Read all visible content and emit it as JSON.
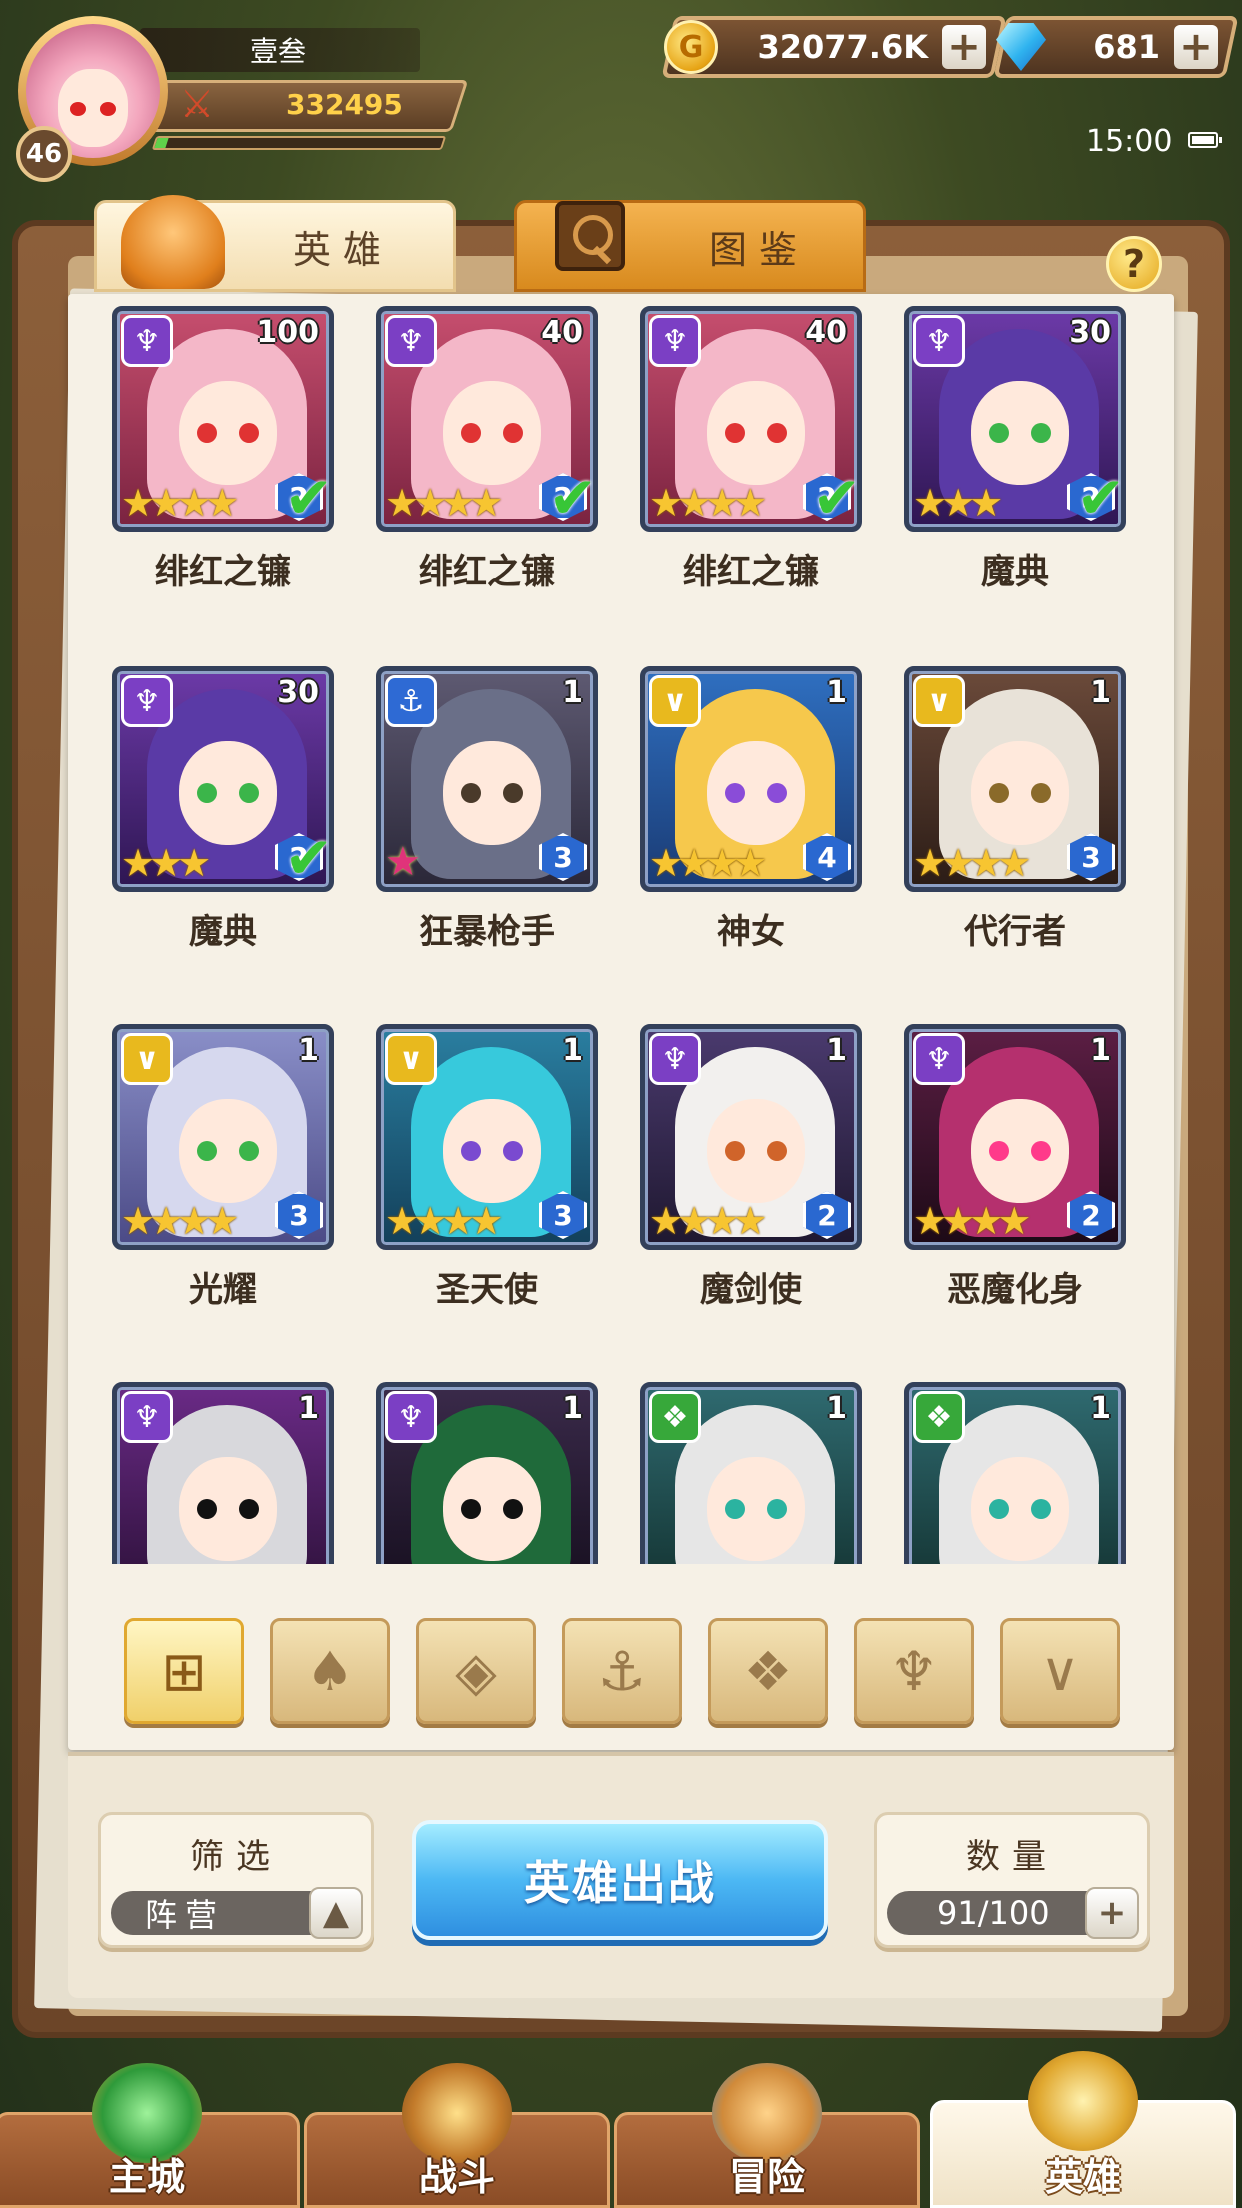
{
  "player": {
    "name": "壹叁",
    "level": "46",
    "power": "332495",
    "exp_fraction": 0.04
  },
  "resources": {
    "gold": "32077.6K",
    "gems": "681",
    "add_symbol": "+"
  },
  "status": {
    "time": "15:00"
  },
  "tabs": {
    "heroes": "英雄",
    "codex": "图鉴"
  },
  "help": {
    "label": "?"
  },
  "heroes": [
    {
      "name": "绯红之镰",
      "level": "100",
      "faction": "dark",
      "stars": 4,
      "rank": "2",
      "deployed": true,
      "theme": "pink"
    },
    {
      "name": "绯红之镰",
      "level": "40",
      "faction": "dark",
      "stars": 4,
      "rank": "2",
      "deployed": true,
      "theme": "pink"
    },
    {
      "name": "绯红之镰",
      "level": "40",
      "faction": "dark",
      "stars": 4,
      "rank": "2",
      "deployed": true,
      "theme": "pink"
    },
    {
      "name": "魔典",
      "level": "30",
      "faction": "dark",
      "stars": 3,
      "rank": "2",
      "deployed": true,
      "theme": "purple"
    },
    {
      "name": "魔典",
      "level": "30",
      "faction": "dark",
      "stars": 3,
      "rank": "2",
      "deployed": true,
      "theme": "purple"
    },
    {
      "name": "狂暴枪手",
      "level": "1",
      "faction": "sea",
      "stars": 0,
      "rank": "3",
      "deployed": false,
      "theme": "gunner",
      "rainbow": true
    },
    {
      "name": "神女",
      "level": "1",
      "faction": "light",
      "stars": 4,
      "rank": "4",
      "deployed": false,
      "theme": "blonde"
    },
    {
      "name": "代行者",
      "level": "1",
      "faction": "light",
      "stars": 4,
      "rank": "3",
      "deployed": false,
      "theme": "silver"
    },
    {
      "name": "光耀",
      "level": "1",
      "faction": "light",
      "stars": 4,
      "rank": "3",
      "deployed": false,
      "theme": "lavender"
    },
    {
      "name": "圣天使",
      "level": "1",
      "faction": "light",
      "stars": 4,
      "rank": "3",
      "deployed": false,
      "theme": "cyan"
    },
    {
      "name": "魔剑使",
      "level": "1",
      "faction": "dark",
      "stars": 4,
      "rank": "2",
      "deployed": false,
      "theme": "white"
    },
    {
      "name": "恶魔化身",
      "level": "1",
      "faction": "dark",
      "stars": 4,
      "rank": "2",
      "deployed": false,
      "theme": "demon"
    },
    {
      "name": "",
      "level": "1",
      "faction": "dark",
      "stars": 0,
      "rank": "",
      "deployed": false,
      "theme": "blindfold"
    },
    {
      "name": "",
      "level": "1",
      "faction": "dark",
      "stars": 0,
      "rank": "",
      "deployed": false,
      "theme": "jester"
    },
    {
      "name": "",
      "level": "1",
      "faction": "beast",
      "stars": 0,
      "rank": "",
      "deployed": false,
      "theme": "elf"
    },
    {
      "name": "",
      "level": "1",
      "faction": "beast",
      "stars": 0,
      "rank": "",
      "deployed": false,
      "theme": "elf"
    }
  ],
  "filters": [
    {
      "id": "all",
      "icon": "grid-icon",
      "glyph": "⊞",
      "active": true
    },
    {
      "id": "nature",
      "icon": "leaf-faction-icon",
      "glyph": "♠",
      "active": false
    },
    {
      "id": "order",
      "icon": "diamond-faction-icon",
      "glyph": "◈",
      "active": false
    },
    {
      "id": "sea",
      "icon": "anchor-faction-icon",
      "glyph": "⚓",
      "active": false
    },
    {
      "id": "beast",
      "icon": "beast-faction-icon",
      "glyph": "❖",
      "active": false
    },
    {
      "id": "dark",
      "icon": "demon-faction-icon",
      "glyph": "♆",
      "active": false
    },
    {
      "id": "light",
      "icon": "wing-faction-icon",
      "glyph": "∨",
      "active": false
    }
  ],
  "filter_box": {
    "title": "筛选",
    "value": "阵营",
    "toggle": "▲"
  },
  "deploy_button": "英雄出战",
  "count_box": {
    "title": "数量",
    "value": "91/100",
    "add": "+"
  },
  "nav": [
    {
      "label": "主城",
      "active": false
    },
    {
      "label": "战斗",
      "active": false
    },
    {
      "label": "冒险",
      "active": false
    },
    {
      "label": "英雄",
      "active": true
    }
  ]
}
